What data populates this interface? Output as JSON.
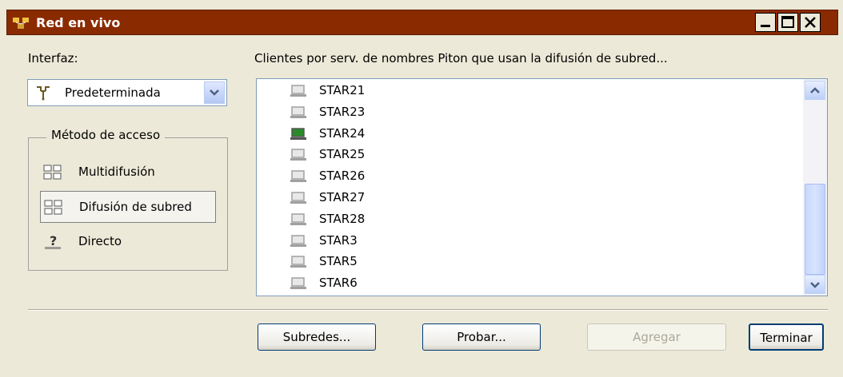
{
  "window": {
    "title": "Red en vivo",
    "accent_color": "#8a2a00"
  },
  "left": {
    "interface_label": "Interfaz:",
    "interface_value": "Predeterminada",
    "access_group_label": "Método de acceso",
    "access_options": [
      {
        "label": "Multidifusión",
        "icon": "multicast-computers-icon",
        "selected": false
      },
      {
        "label": "Difusión de subred",
        "icon": "subnet-broadcast-computers-icon",
        "selected": true
      },
      {
        "label": "Directo",
        "icon": "direct-question-icon",
        "selected": false
      }
    ]
  },
  "right": {
    "clients_label": "Clientes por serv. de nombres Piton que usan la difusión de subred...",
    "clients": [
      {
        "name": "STAR21",
        "active": false
      },
      {
        "name": "STAR23",
        "active": false
      },
      {
        "name": "STAR24",
        "active": true
      },
      {
        "name": "STAR25",
        "active": false
      },
      {
        "name": "STAR26",
        "active": false
      },
      {
        "name": "STAR27",
        "active": false
      },
      {
        "name": "STAR28",
        "active": false
      },
      {
        "name": "STAR3",
        "active": false
      },
      {
        "name": "STAR5",
        "active": false
      },
      {
        "name": "STAR6",
        "active": false
      }
    ]
  },
  "buttons": {
    "subnets": "Subredes...",
    "test": "Probar...",
    "add": "Agregar",
    "finish": "Terminar"
  }
}
